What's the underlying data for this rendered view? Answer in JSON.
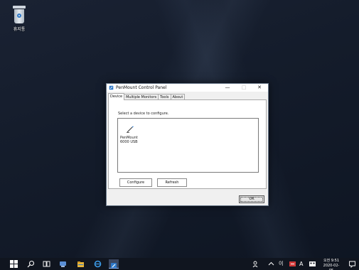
{
  "desktop": {
    "recycle_bin_label": "휴지통"
  },
  "dialog": {
    "title": "PenMount Control Panel",
    "buttons": {
      "minimize": "—",
      "maximize": "□",
      "close": "✕"
    },
    "tabs": [
      {
        "label": "Device",
        "active": true
      },
      {
        "label": "Multiple Monitors",
        "active": false
      },
      {
        "label": "Tools",
        "active": false
      },
      {
        "label": "About",
        "active": false
      }
    ],
    "device_tab": {
      "instruction": "Select a device to configure.",
      "devices": [
        {
          "name_line1": "PenMount",
          "name_line2": "6000 USB"
        }
      ],
      "configure_label": "Configure",
      "refresh_label": "Refresh"
    },
    "ok_label": "OK"
  },
  "taskbar": {
    "ime_label": "이",
    "input_label": "A",
    "clock_time": "오전 9:51",
    "clock_date": "2020-02-05"
  },
  "colors": {
    "desktop_bg": "#141c2b",
    "taskbar_bg": "#10151f",
    "accent": "#2f79c9"
  }
}
